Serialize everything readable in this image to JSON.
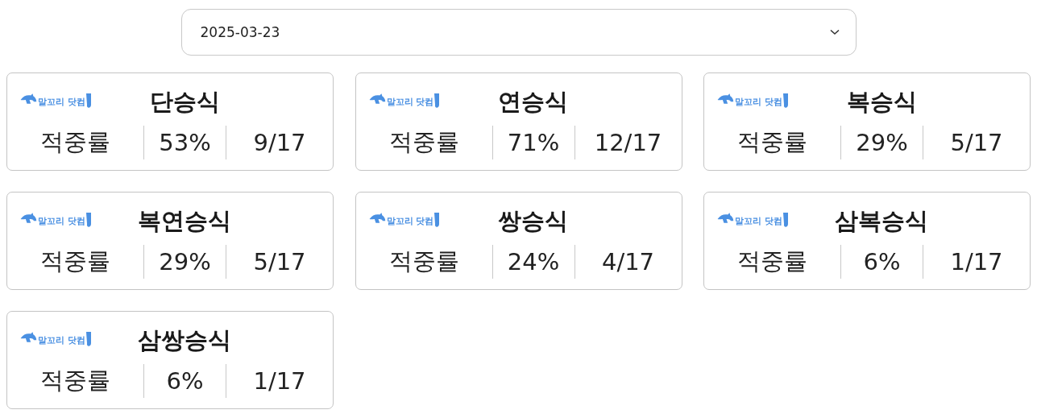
{
  "date_select": {
    "value": "2025-03-23"
  },
  "cards": [
    {
      "logo": "말꼬리 닷컴",
      "title": "단승식",
      "label": "적중률",
      "rate": "53%",
      "count": "9/17"
    },
    {
      "logo": "말꼬리 닷컴",
      "title": "연승식",
      "label": "적중률",
      "rate": "71%",
      "count": "12/17"
    },
    {
      "logo": "말꼬리 닷컴",
      "title": "복승식",
      "label": "적중률",
      "rate": "29%",
      "count": "5/17"
    },
    {
      "logo": "말꼬리 닷컴",
      "title": "복연승식",
      "label": "적중률",
      "rate": "29%",
      "count": "5/17"
    },
    {
      "logo": "말꼬리 닷컴",
      "title": "쌍승식",
      "label": "적중률",
      "rate": "24%",
      "count": "4/17"
    },
    {
      "logo": "말꼬리 닷컴",
      "title": "삼복승식",
      "label": "적중률",
      "rate": "6%",
      "count": "1/17"
    },
    {
      "logo": "말꼬리 닷컴",
      "title": "삼쌍승식",
      "label": "적중률",
      "rate": "6%",
      "count": "1/17"
    }
  ]
}
